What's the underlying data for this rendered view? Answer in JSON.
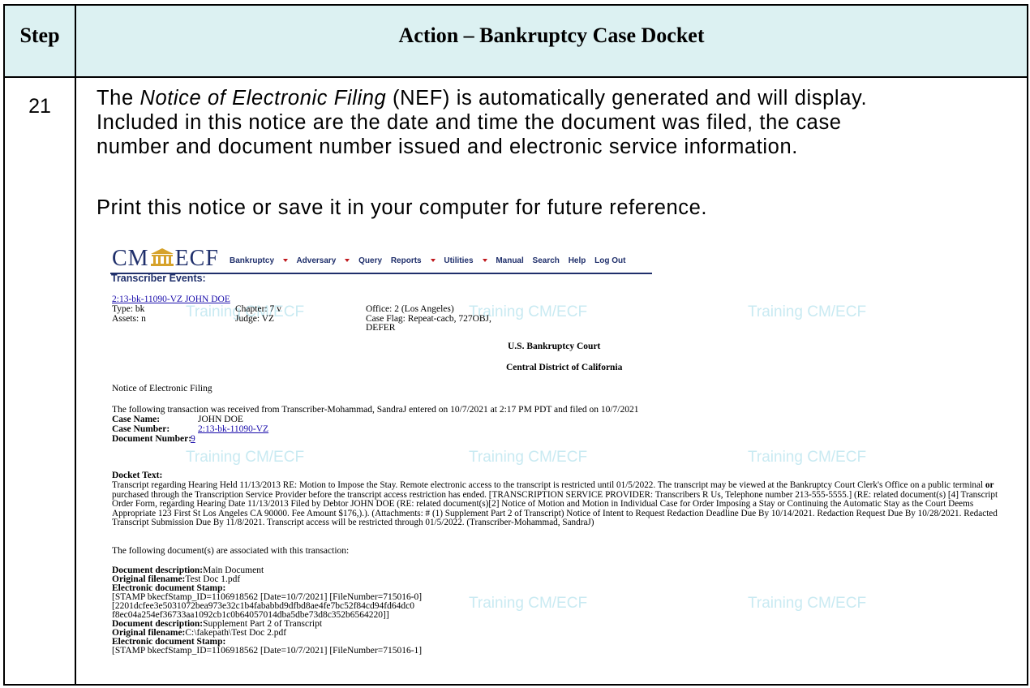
{
  "header": {
    "step_label": "Step",
    "action_label": "Action – Bankruptcy Case Docket"
  },
  "step": {
    "number": "21",
    "para1_pre": "The ",
    "para1_italic": "Notice of Electronic Filing",
    "para1_post_line1": " (NEF) is automatically generated and will display.",
    "para1_line2": "Included in this notice are the date and time the document was filed, the case",
    "para1_line3": "number and document number issued and electronic service information.",
    "para2": "Print this notice or save it in your computer for future reference."
  },
  "ecf": {
    "logo_left": "CM",
    "logo_right": "ECF",
    "menu": [
      "Bankruptcy",
      "Adversary",
      "Query",
      "Reports",
      "Utilities",
      "Manual",
      "Search",
      "Help",
      "Log Out"
    ],
    "menu_has_caret": [
      true,
      true,
      false,
      true,
      true,
      false,
      false,
      false,
      false
    ],
    "page_title": "Transcriber Events:",
    "case_link": "2:13-bk-11090-VZ JOHN DOE",
    "type": "Type: bk",
    "chapter": "Chapter: 7 v",
    "office": "Office: 2 (Los Angeles)",
    "assets": "Assets: n",
    "judge": "Judge: VZ",
    "case_flag_1": "Case Flag: Repeat-cacb, 727OBJ,",
    "case_flag_2": "DEFER",
    "court_1": "U.S. Bankruptcy Court",
    "court_2": "Central District of California",
    "nef_title": "Notice of Electronic Filing",
    "transaction_line": "The following transaction was received from Transcriber-Mohammad, SandraJ entered on 10/7/2021 at 2:17 PM PDT and filed on 10/7/2021",
    "case_name_label": "Case Name:",
    "case_name_value": "JOHN DOE",
    "case_number_label": "Case Number:",
    "case_number_value": "2:13-bk-11090-VZ",
    "doc_number_label": "Document Number:",
    "doc_number_value": "9",
    "docket_label": "Docket Text:",
    "docket_text_a": "Transcript regarding Hearing Held 11/13/2013 RE: Motion to Impose the Stay. Remote electronic access to the transcript is restricted until 01/5/2022. The transcript may be viewed at the Bankruptcy Court Clerk's Office on a public terminal ",
    "docket_text_or": "or",
    "docket_text_b": " purchased through the Transcription Service Provider before the transcript access restriction has ended. [TRANSCRIPTION SERVICE PROVIDER: Transcribers R Us, Telephone number 213-555-5555.] (RE: related document(s) [4] Transcript Order Form, regarding Hearing Date 11/13/2013 Filed by Debtor JOHN DOE (RE: related document(s)[2] Notice of Motion and Motion in Individual Case for Order Imposing a Stay or Continuing the Automatic Stay as the Court Deems Appropriate 123 First St Los Angeles CA 90000. Fee Amount $176,).). (Attachments: # (1) Supplement Part 2 of Transcript) Notice of Intent to Request Redaction Deadline Due By 10/14/2021. Redaction Request Due By 10/28/2021. Redacted Transcript Submission Due By 11/8/2021. Transcript access will be restricted through 01/5/2022. (Transcriber-Mohammad, SandraJ)",
    "assoc_line": "The following document(s) are associated with this transaction:",
    "doc1_desc_label": "Document description:",
    "doc1_desc_value": "Main Document",
    "doc1_file_label": "Original filename:",
    "doc1_file_value": "Test Doc 1.pdf",
    "stamp_label": "Electronic document Stamp:",
    "doc1_stamp_1": "[STAMP bkecfStamp_ID=1106918562 [Date=10/7/2021] [FileNumber=715016-0]",
    "doc1_stamp_2": "[2201dcfee3e5031072bea973e32c1b4fababbd9dfbd8ae4fe7bc52f84cd94fd64dc0",
    "doc1_stamp_3": "f8ec04a254ef36733aa1092cb1c0b64057014dba5dbe73d8c352b6564220]]",
    "doc2_desc_label": "Document description:",
    "doc2_desc_value": "Supplement Part 2 of Transcript",
    "doc2_file_label": "Original filename:",
    "doc2_file_value": "C:\\fakepath\\Test Doc 2.pdf",
    "doc2_stamp_1": "[STAMP bkecfStamp_ID=1106918562 [Date=10/7/2021] [FileNumber=715016-1]",
    "watermark": "Training CM/ECF"
  },
  "colors": {
    "header_bg": "#dcf1f2",
    "ecf_navy": "#1f2f6b",
    "caret_red": "#c0181d",
    "watermark": "#c9eaf2",
    "link": "#1a0dab"
  }
}
